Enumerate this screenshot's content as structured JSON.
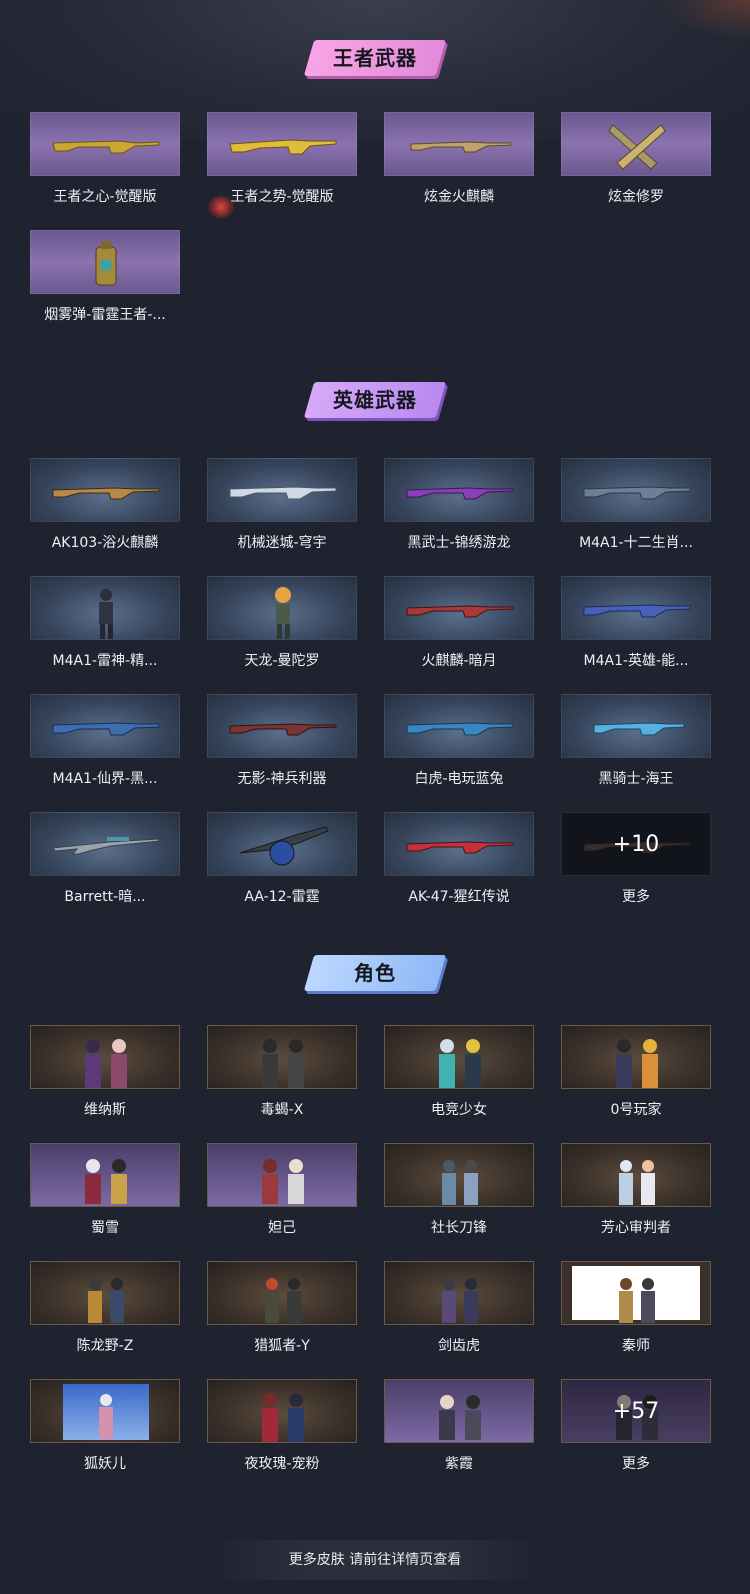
{
  "sections": {
    "king": {
      "title": "王者武器",
      "items": [
        {
          "label": "王者之心-觉醒版",
          "icon": "golden-rifle-icon"
        },
        {
          "label": "王者之势-觉醒版",
          "icon": "golden-rifle-icon"
        },
        {
          "label": "炫金火麒麟",
          "icon": "golden-rifle-icon"
        },
        {
          "label": "炫金修罗",
          "icon": "golden-smg-icon"
        },
        {
          "label": "烟雾弹-雷霆王者-...",
          "icon": "smoke-grenade-icon"
        }
      ]
    },
    "hero": {
      "title": "英雄武器",
      "items": [
        {
          "label": "AK103-浴火麒麟"
        },
        {
          "label": "机械迷城-穹宇"
        },
        {
          "label": "黑武士-锦绣游龙"
        },
        {
          "label": "M4A1-十二生肖..."
        },
        {
          "label": "M4A1-雷神-精..."
        },
        {
          "label": "天龙-曼陀罗"
        },
        {
          "label": "火麒麟-暗月"
        },
        {
          "label": "M4A1-英雄-能..."
        },
        {
          "label": "M4A1-仙界-黑..."
        },
        {
          "label": "无影-神兵利器"
        },
        {
          "label": "白虎-电玩蓝兔"
        },
        {
          "label": "黑骑士-海王"
        },
        {
          "label": "Barrett-暗..."
        },
        {
          "label": "AA-12-雷霆"
        },
        {
          "label": "AK-47-猩红传说"
        },
        {
          "label": "更多",
          "more": "+10"
        }
      ]
    },
    "role": {
      "title": "角色",
      "items": [
        {
          "label": "维纳斯"
        },
        {
          "label": "毒蝎-X"
        },
        {
          "label": "电竞少女"
        },
        {
          "label": "0号玩家"
        },
        {
          "label": "蜀雪"
        },
        {
          "label": "妲己"
        },
        {
          "label": "社长刀锋"
        },
        {
          "label": "芳心审判者"
        },
        {
          "label": "陈龙野-Z"
        },
        {
          "label": "猎狐者-Y"
        },
        {
          "label": "剑齿虎"
        },
        {
          "label": "秦师"
        },
        {
          "label": "狐妖儿"
        },
        {
          "label": "夜玫瑰-宠粉"
        },
        {
          "label": "紫霞"
        },
        {
          "label": "更多",
          "more": "+57"
        }
      ]
    }
  },
  "footer": {
    "label": "更多皮肤 请前往详情页查看"
  }
}
